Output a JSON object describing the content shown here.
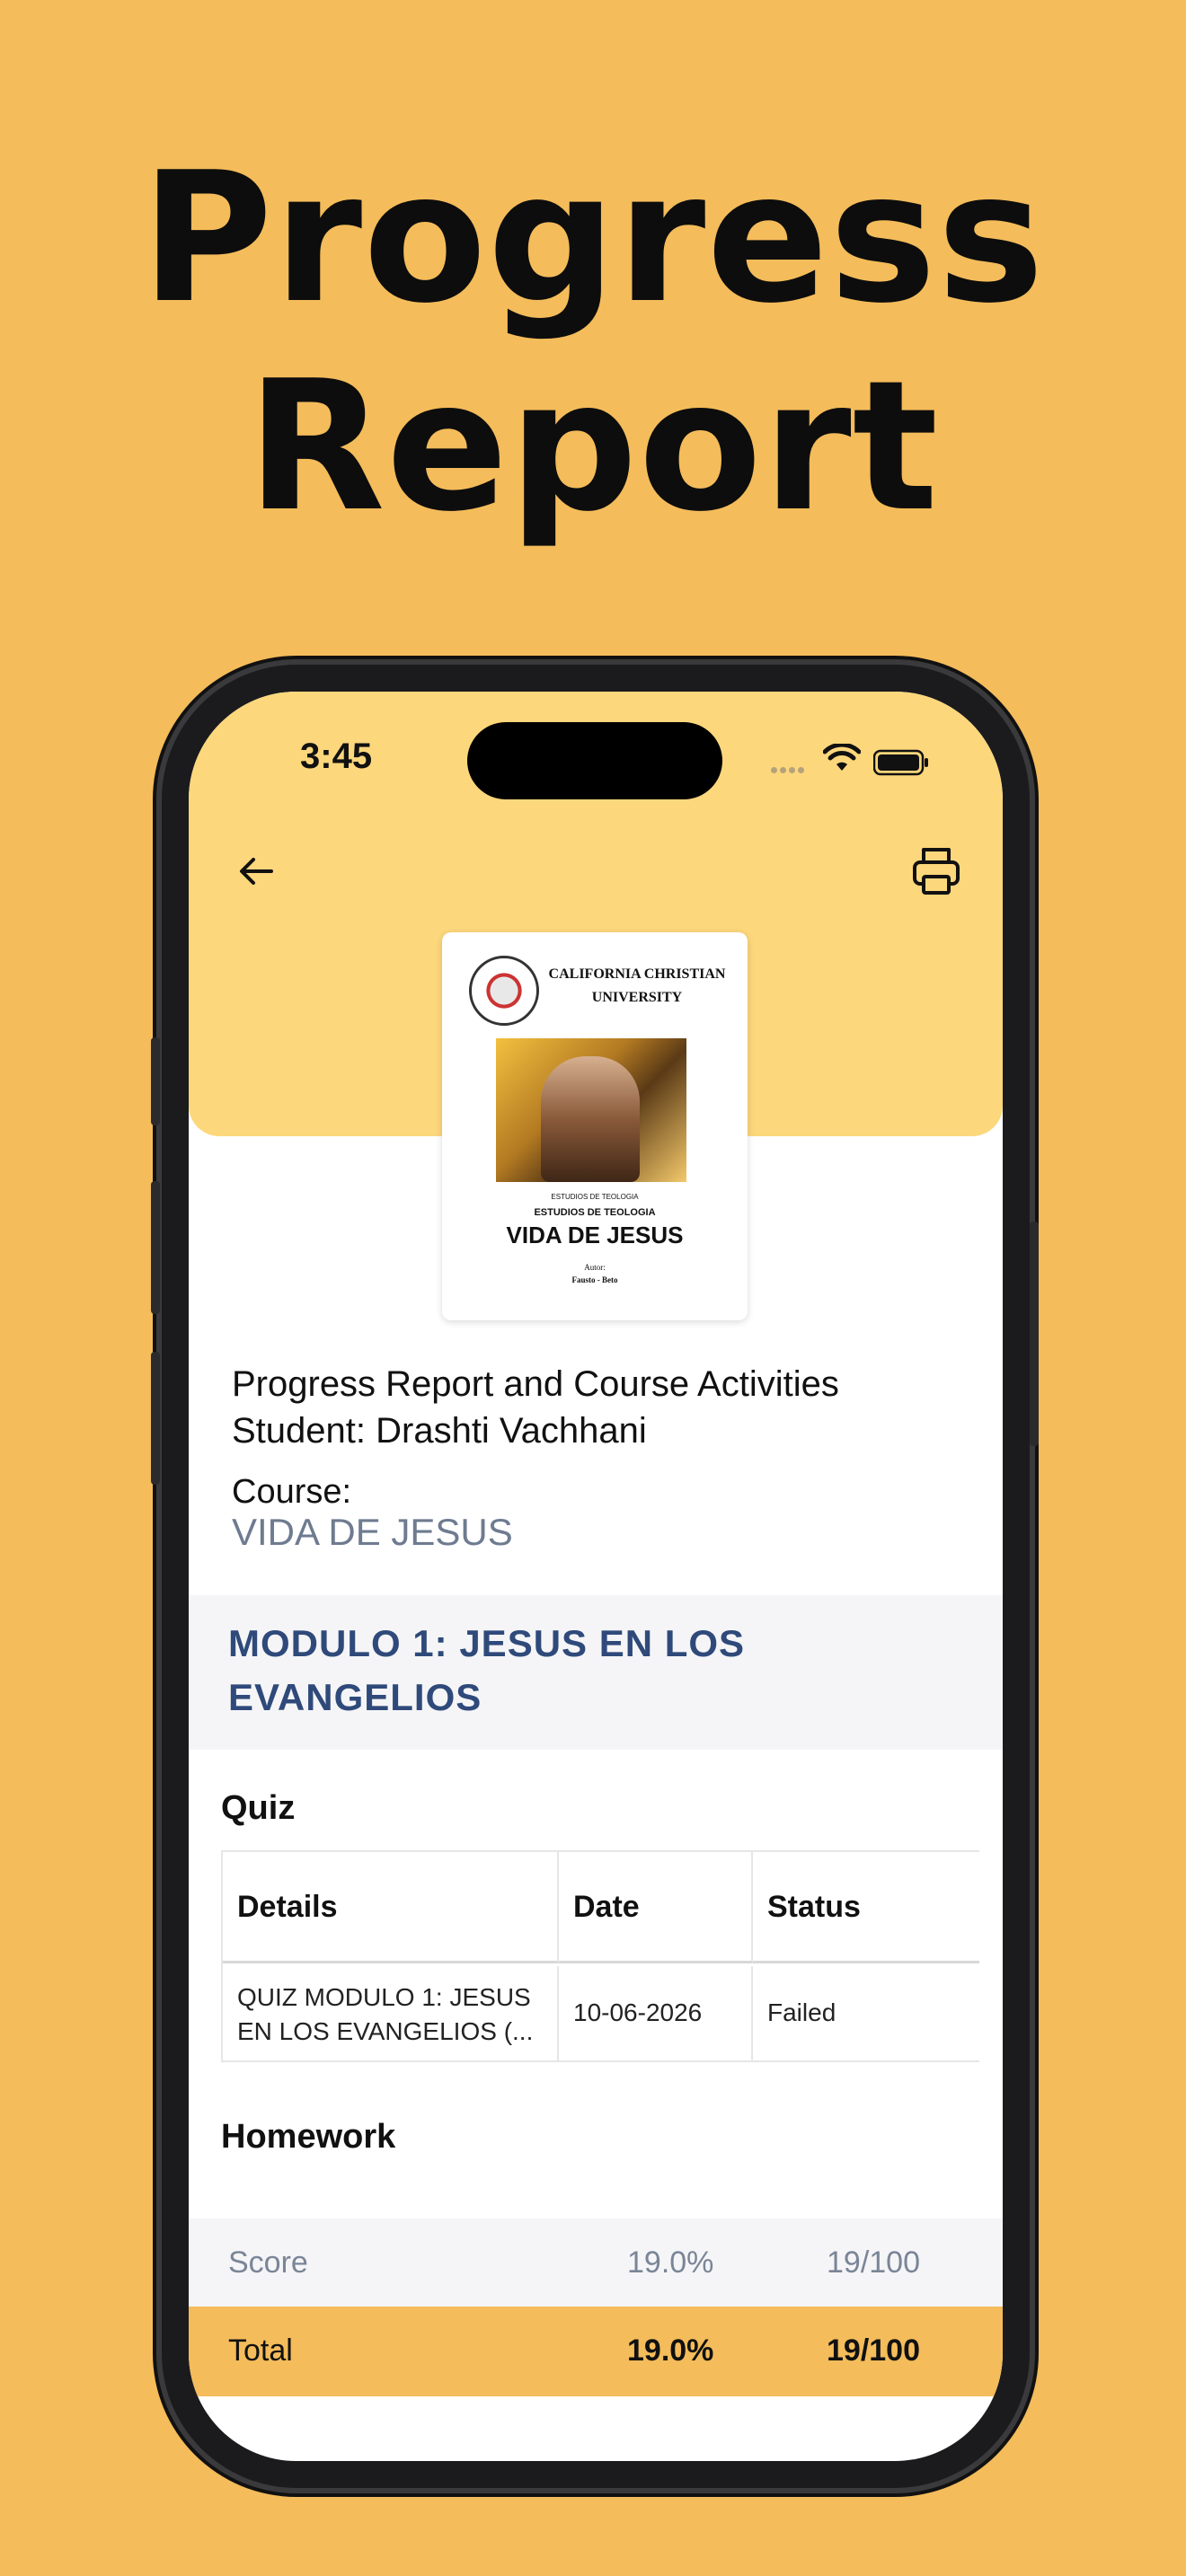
{
  "headline": {
    "line1": "Progress",
    "line2": "Report"
  },
  "status_bar": {
    "time": "3:45"
  },
  "toolbar": {
    "back_icon": "arrow-left-icon",
    "print_icon": "printer-icon"
  },
  "cover": {
    "university": "CALIFORNIA CHRISTIAN UNIVERSITY",
    "small_caption": "ESTUDIOS DE TEOLOGIA",
    "subtitle": "ESTUDIOS DE TEOLOGIA",
    "title": "VIDA DE JESUS",
    "author_label": "Autor:",
    "author": "Fausto - Beto"
  },
  "report": {
    "title_line1": "Progress Report and Course Activities",
    "title_line2": "Student: Drashti Vachhani",
    "course_label": "Course:",
    "course_value": "VIDA DE JESUS"
  },
  "module": {
    "title": "MODULO 1: JESUS EN LOS EVANGELIOS"
  },
  "quiz": {
    "heading": "Quiz",
    "columns": [
      "Details",
      "Date",
      "Status"
    ],
    "rows": [
      {
        "details_line1": "QUIZ MODULO 1: JESUS",
        "details_line2": "EN LOS EVANGELIOS  (...",
        "date": "10-06-2026",
        "status": "Failed"
      }
    ]
  },
  "homework": {
    "heading": "Homework"
  },
  "summary": {
    "score": {
      "label": "Score",
      "percent": "19.0%",
      "points": "19/100"
    },
    "total": {
      "label": "Total",
      "percent": "19.0%",
      "points": "19/100"
    }
  },
  "colors": {
    "background": "#F4BC5A",
    "header_band": "#FDD77C",
    "module_title": "#2F4A7A",
    "muted": "#7a8597"
  }
}
